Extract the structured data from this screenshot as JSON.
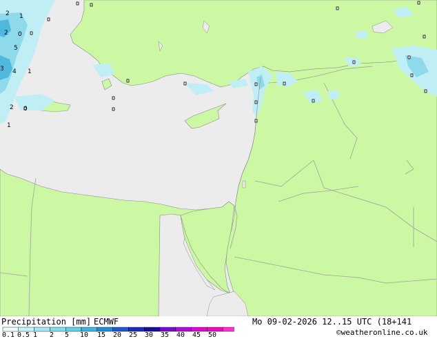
{
  "map": {
    "colors": {
      "sea": "#ececec",
      "land": "#ccf8a4",
      "precip_light": "#bfeff5",
      "precip_mid": "#8fdaea",
      "precip_heavy": "#4fb9dd",
      "border": "#a0a0a0"
    },
    "point_labels": [
      "2",
      "1",
      "2",
      "0",
      "5",
      "3",
      "4",
      "1",
      "2",
      "0",
      "1"
    ]
  },
  "footer": {
    "title": "Precipitation [mm]",
    "model": "ECMWF",
    "datetime": "Mo 09-02-2026 12..15 UTC (18+141",
    "credit": "©weatheronline.co.uk",
    "scale_ticks": [
      "0.1",
      "0.5",
      "1",
      "2",
      "5",
      "10",
      "15",
      "20",
      "25",
      "30",
      "35",
      "40",
      "45",
      "50"
    ],
    "scale_colors": [
      "#ebfbfd",
      "#c6f2f8",
      "#a4e8f3",
      "#80dcef",
      "#5fcfea",
      "#3fb5e2",
      "#1f8ed6",
      "#1a5bcf",
      "#1a2fb4",
      "#1a0e95",
      "#7a0dcc",
      "#b00dd6",
      "#d80dcf",
      "#e80dbf",
      "#ff30d0"
    ]
  }
}
